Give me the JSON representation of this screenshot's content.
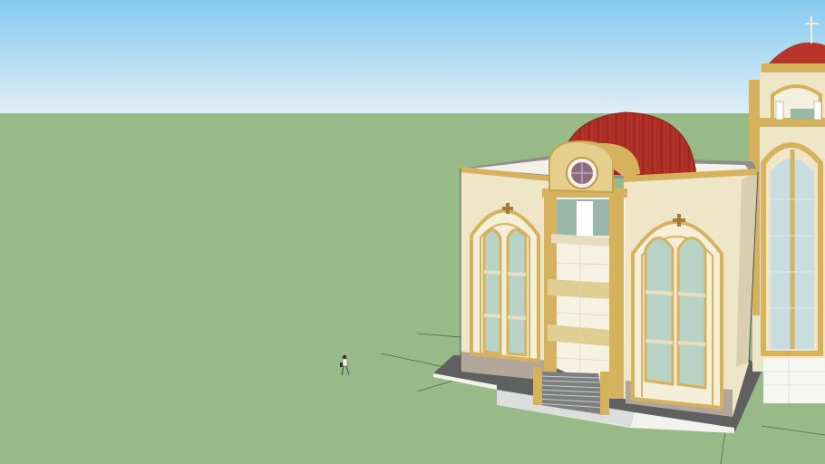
{
  "viewport": {
    "sky_top_color": "#8ccdf2",
    "sky_bottom_color": "#dcedf6",
    "ground_color": "#98ba88"
  },
  "building": {
    "dome_color": "#b8332a",
    "wall_color": "#efe6c8",
    "trim_color": "#d6b25e",
    "window_color": "#b8d2c6",
    "base_color": "#b1a699",
    "platform_color": "#5f6260",
    "cross_symbol": "cross-icon"
  },
  "figure": {
    "icon": "person-figure-icon"
  }
}
